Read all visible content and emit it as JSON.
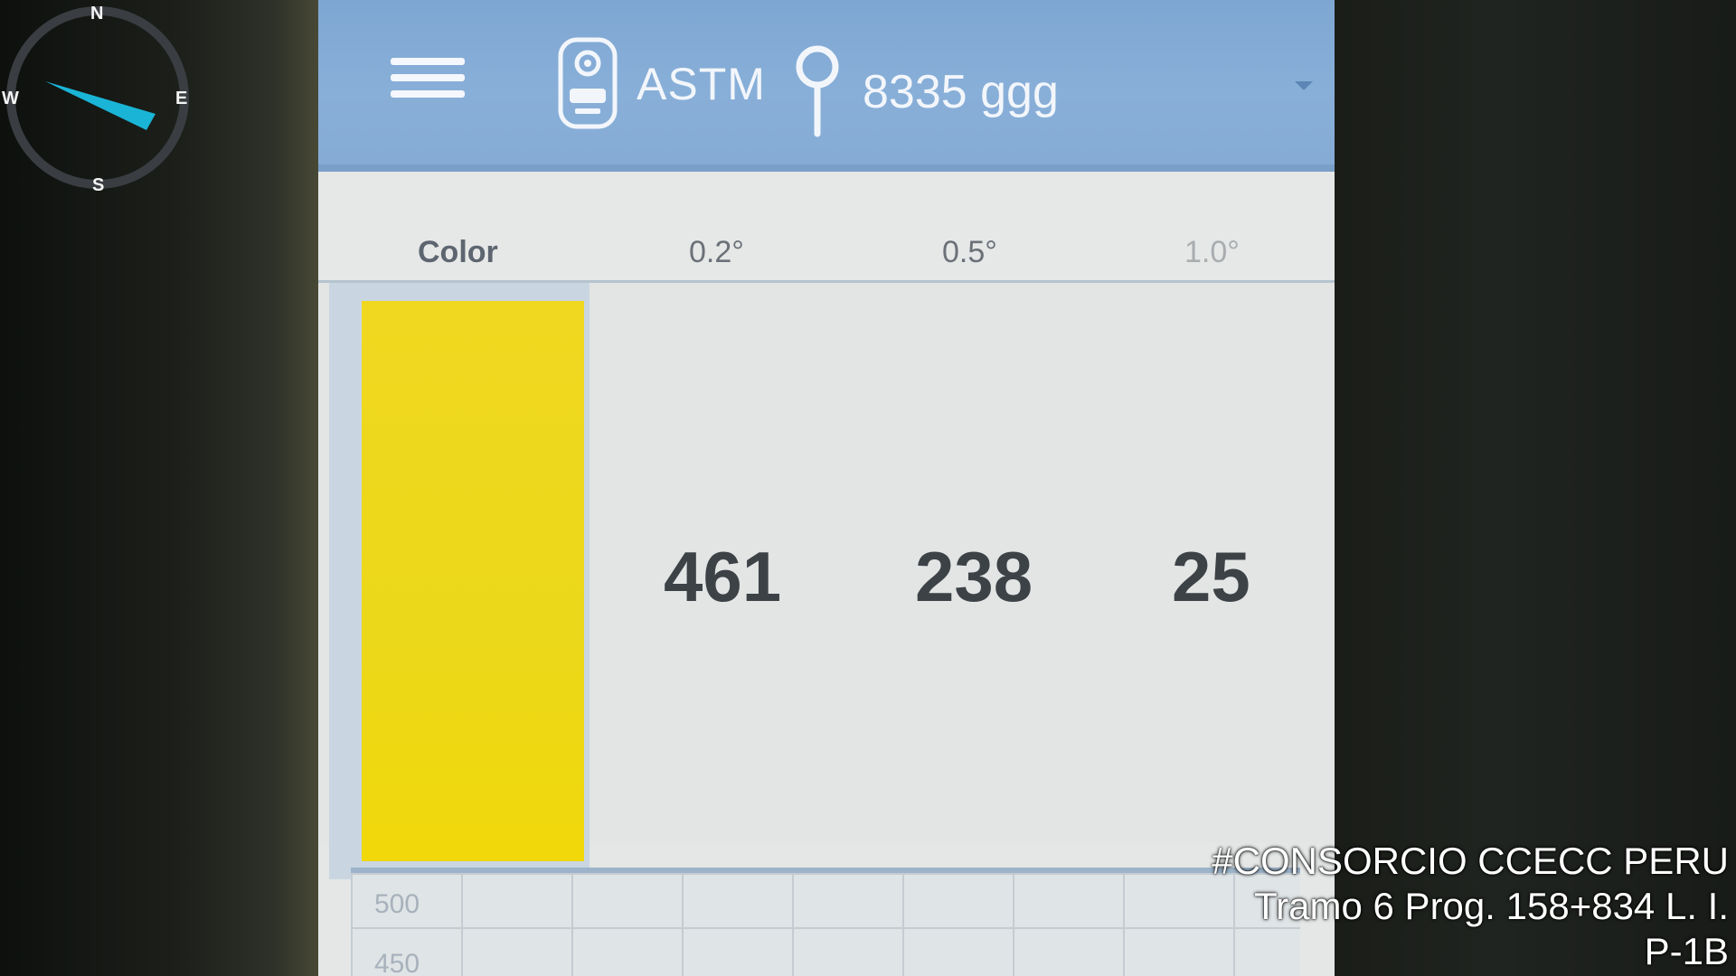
{
  "compass": {
    "north": "N",
    "south": "S",
    "west": "W",
    "east": "E",
    "needle_color": "#1ab4d6"
  },
  "topbar": {
    "menu_icon": "hamburger-menu-icon",
    "device_icon": "retroreflectometer-icon",
    "standard_label": "ASTM",
    "location_icon": "map-pin-icon",
    "site_label": "8335 ggg",
    "dropdown_icon": "chevron-down-icon",
    "background_color": "#86acd6"
  },
  "table": {
    "headers": {
      "color": "Color",
      "angle_1": "0.2°",
      "angle_2": "0.5°",
      "angle_3": "1.0°"
    },
    "row": {
      "color_swatch": "#ecd81a",
      "value_1": "461",
      "value_2": "238",
      "value_3": "25"
    }
  },
  "graph": {
    "label_top": "500",
    "label_bottom": "450"
  },
  "watermark": {
    "line1": "#CONSORCIO CCECC PERU",
    "line2": "Tramo 6 Prog. 158+834 L. I.",
    "line3": "P-1B"
  }
}
